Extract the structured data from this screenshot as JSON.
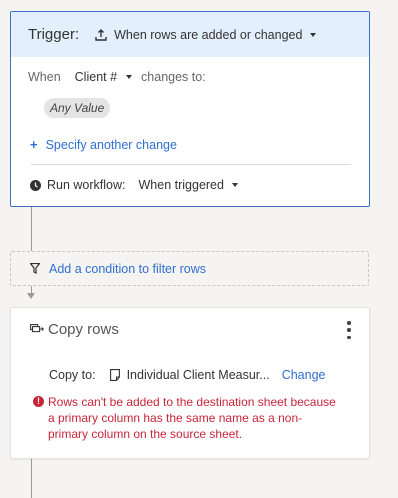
{
  "trigger": {
    "title": "Trigger:",
    "event_label": "When rows are added or changed",
    "when_label": "When",
    "column_select": "Client #",
    "changes_to_label": "changes to:",
    "value_chip": "Any Value",
    "specify_plus": "+",
    "specify_link": "Specify another change",
    "run_label": "Run workflow:",
    "run_select": "When triggered"
  },
  "condition": {
    "add_label": "Add a condition to filter rows"
  },
  "copy_block": {
    "title": "Copy rows",
    "copy_to_label": "Copy to:",
    "destination_sheet": "Individual Client Measur...",
    "change_link": "Change",
    "error_icon_glyph": "!",
    "error_message": "Rows can't be added to the destination sheet because a primary column has the same name as a non-primary column on the source sheet."
  },
  "colors": {
    "accent_blue": "#2f6fce",
    "trigger_border": "#3a6fc4",
    "trigger_header_bg": "#e3effc",
    "error_red": "#c8253a"
  }
}
